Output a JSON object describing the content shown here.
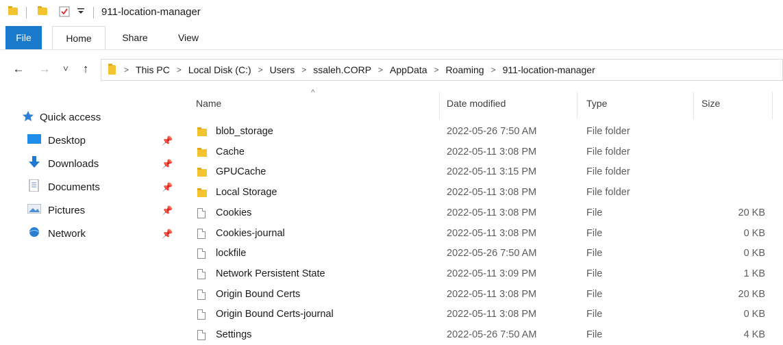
{
  "window": {
    "title": "911-location-manager"
  },
  "quick_access_toolbar": {
    "icons": [
      "folder-icon",
      "folder-icon",
      "properties-checkmark-icon",
      "customize-dropdown-icon"
    ]
  },
  "ribbon": {
    "tabs": [
      {
        "label": "File",
        "active": false,
        "style": "file"
      },
      {
        "label": "Home",
        "active": true
      },
      {
        "label": "Share",
        "active": false
      },
      {
        "label": "View",
        "active": false
      }
    ]
  },
  "navigation": {
    "back_icon": "←",
    "forward_icon": "→",
    "recent_icon": "˅",
    "up_icon": "↑"
  },
  "address_bar": {
    "breadcrumb": [
      "This PC",
      "Local Disk (C:)",
      "Users",
      "ssaleh.CORP",
      "AppData",
      "Roaming",
      "911-location-manager"
    ]
  },
  "nav_pane": {
    "quick_access_label": "Quick access",
    "items": [
      {
        "label": "Desktop",
        "icon": "desktop-icon",
        "pinned": true
      },
      {
        "label": "Downloads",
        "icon": "downloads-icon",
        "pinned": true
      },
      {
        "label": "Documents",
        "icon": "documents-icon",
        "pinned": true
      },
      {
        "label": "Pictures",
        "icon": "pictures-icon",
        "pinned": true
      },
      {
        "label": "Network",
        "icon": "network-icon",
        "pinned": true
      }
    ]
  },
  "file_list": {
    "columns": {
      "name": "Name",
      "date": "Date modified",
      "type": "Type",
      "size": "Size"
    },
    "sort_indicator": "^",
    "rows": [
      {
        "name": "blob_storage",
        "date": "2022-05-26 7:50 AM",
        "type": "File folder",
        "size": "",
        "kind": "folder"
      },
      {
        "name": "Cache",
        "date": "2022-05-11 3:08 PM",
        "type": "File folder",
        "size": "",
        "kind": "folder"
      },
      {
        "name": "GPUCache",
        "date": "2022-05-11 3:15 PM",
        "type": "File folder",
        "size": "",
        "kind": "folder"
      },
      {
        "name": "Local Storage",
        "date": "2022-05-11 3:08 PM",
        "type": "File folder",
        "size": "",
        "kind": "folder"
      },
      {
        "name": "Cookies",
        "date": "2022-05-11 3:08 PM",
        "type": "File",
        "size": "20 KB",
        "kind": "file"
      },
      {
        "name": "Cookies-journal",
        "date": "2022-05-11 3:08 PM",
        "type": "File",
        "size": "0 KB",
        "kind": "file"
      },
      {
        "name": "lockfile",
        "date": "2022-05-26 7:50 AM",
        "type": "File",
        "size": "0 KB",
        "kind": "file"
      },
      {
        "name": "Network Persistent State",
        "date": "2022-05-11 3:09 PM",
        "type": "File",
        "size": "1 KB",
        "kind": "file"
      },
      {
        "name": "Origin Bound Certs",
        "date": "2022-05-11 3:08 PM",
        "type": "File",
        "size": "20 KB",
        "kind": "file"
      },
      {
        "name": "Origin Bound Certs-journal",
        "date": "2022-05-11 3:08 PM",
        "type": "File",
        "size": "0 KB",
        "kind": "file"
      },
      {
        "name": "Settings",
        "date": "2022-05-26 7:50 AM",
        "type": "File",
        "size": "4 KB",
        "kind": "file"
      }
    ]
  },
  "colors": {
    "file_tab": "#1979ca",
    "folder": "#f4c430"
  }
}
